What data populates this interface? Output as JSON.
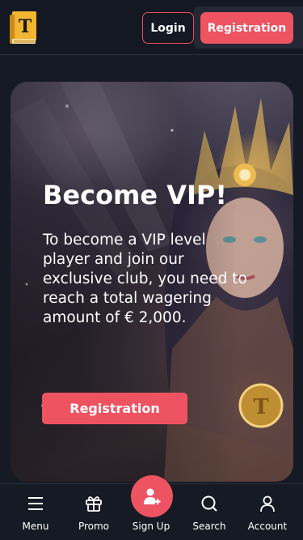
{
  "header": {
    "logo_letter": "T",
    "login_label": "Login",
    "registration_label": "Registration"
  },
  "hero": {
    "title": "Become VIP!",
    "text": "To become a VIP level player and join our exclusive club, you need to reach a total wagering amount of € 2,000.",
    "button_label": "Registration"
  },
  "bottom_nav": {
    "items": [
      {
        "label": "Menu",
        "icon": "hamburger-menu-icon"
      },
      {
        "label": "Promo",
        "icon": "gift-icon"
      },
      {
        "label": "Sign Up",
        "icon": "add-user-icon"
      },
      {
        "label": "Search",
        "icon": "search-icon"
      },
      {
        "label": "Account",
        "icon": "user-icon"
      }
    ]
  },
  "colors": {
    "accent": "#ee5362",
    "background": "#161a24",
    "logo_gold": "#f2b632"
  }
}
